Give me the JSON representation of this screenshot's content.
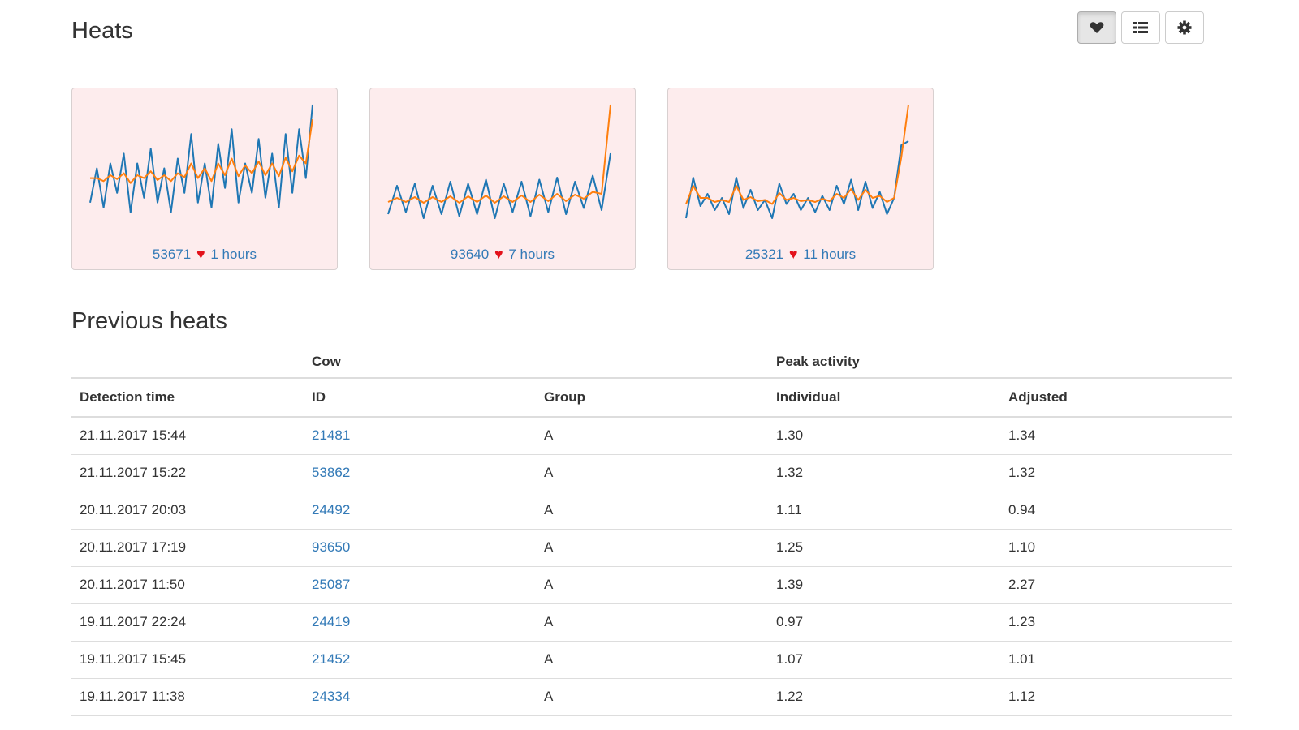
{
  "header": {
    "title": "Heats",
    "toolbar": [
      {
        "name": "heart-button",
        "icon": "heart-icon",
        "active": true
      },
      {
        "name": "list-button",
        "icon": "list-icon",
        "active": false
      },
      {
        "name": "settings-button",
        "icon": "gear-icon",
        "active": false
      }
    ]
  },
  "current_heats": [
    {
      "cow_id": "53671",
      "icon": "heart-icon",
      "elapsed": "1 hours"
    },
    {
      "cow_id": "93640",
      "icon": "heart-icon",
      "elapsed": "7 hours"
    },
    {
      "cow_id": "25321",
      "icon": "heart-icon",
      "elapsed": "11 hours"
    }
  ],
  "colors": {
    "card_background": "#fdeced",
    "raw_activity_line": "#1f77b4",
    "smoothed_activity_line": "#ff7f0e",
    "heart": "#e3121b",
    "link": "#337ab7"
  },
  "chart_data": [
    {
      "type": "line",
      "series": [
        {
          "values": [
            0.2,
            0.55,
            0.15,
            0.6,
            0.3,
            0.7,
            0.1,
            0.6,
            0.25,
            0.75,
            0.2,
            0.55,
            0.1,
            0.65,
            0.3,
            0.9,
            0.2,
            0.6,
            0.15,
            0.8,
            0.35,
            0.95,
            0.2,
            0.6,
            0.3,
            0.85,
            0.25,
            0.7,
            0.15,
            0.9,
            0.3,
            0.95,
            0.45,
            1.2
          ]
        },
        {
          "values": [
            0.45,
            0.45,
            0.42,
            0.48,
            0.44,
            0.5,
            0.4,
            0.48,
            0.45,
            0.52,
            0.43,
            0.48,
            0.42,
            0.5,
            0.46,
            0.6,
            0.45,
            0.55,
            0.42,
            0.6,
            0.48,
            0.65,
            0.47,
            0.58,
            0.5,
            0.62,
            0.48,
            0.6,
            0.47,
            0.66,
            0.52,
            0.68,
            0.6,
            1.05
          ]
        }
      ]
    },
    {
      "type": "line",
      "series": [
        {
          "values": [
            0.2,
            0.9,
            0.25,
            0.95,
            0.1,
            0.9,
            0.2,
            1.0,
            0.15,
            0.95,
            0.2,
            1.05,
            0.1,
            0.95,
            0.25,
            1.0,
            0.15,
            1.05,
            0.25,
            1.1,
            0.2,
            1.0,
            0.35,
            1.15,
            0.3,
            1.7
          ]
        },
        {
          "values": [
            0.5,
            0.6,
            0.5,
            0.62,
            0.48,
            0.62,
            0.5,
            0.64,
            0.48,
            0.64,
            0.5,
            0.66,
            0.48,
            0.64,
            0.5,
            0.66,
            0.5,
            0.68,
            0.52,
            0.7,
            0.52,
            0.68,
            0.58,
            0.75,
            0.7,
            2.9
          ]
        }
      ]
    },
    {
      "type": "line",
      "series": [
        {
          "values": [
            0.1,
            1.1,
            0.4,
            0.7,
            0.3,
            0.6,
            0.2,
            1.1,
            0.35,
            0.8,
            0.3,
            0.55,
            0.1,
            0.95,
            0.45,
            0.7,
            0.3,
            0.6,
            0.25,
            0.65,
            0.3,
            0.9,
            0.45,
            1.05,
            0.3,
            1.0,
            0.35,
            0.75,
            0.2,
            0.6,
            1.9,
            2.0
          ]
        },
        {
          "values": [
            0.45,
            0.9,
            0.6,
            0.6,
            0.5,
            0.55,
            0.5,
            0.9,
            0.55,
            0.62,
            0.52,
            0.55,
            0.45,
            0.72,
            0.55,
            0.6,
            0.52,
            0.55,
            0.5,
            0.58,
            0.52,
            0.7,
            0.6,
            0.82,
            0.55,
            0.8,
            0.6,
            0.65,
            0.5,
            0.6,
            1.6,
            2.9
          ]
        }
      ]
    }
  ],
  "previous_heats": {
    "title": "Previous heats",
    "group_headers": {
      "cow": "Cow",
      "peak_activity": "Peak activity"
    },
    "columns": [
      "Detection time",
      "ID",
      "Group",
      "Individual",
      "Adjusted"
    ],
    "rows": [
      {
        "time": "21.11.2017 15:44",
        "id": "21481",
        "group": "A",
        "individual": "1.30",
        "adjusted": "1.34"
      },
      {
        "time": "21.11.2017 15:22",
        "id": "53862",
        "group": "A",
        "individual": "1.32",
        "adjusted": "1.32"
      },
      {
        "time": "20.11.2017 20:03",
        "id": "24492",
        "group": "A",
        "individual": "1.11",
        "adjusted": "0.94"
      },
      {
        "time": "20.11.2017 17:19",
        "id": "93650",
        "group": "A",
        "individual": "1.25",
        "adjusted": "1.10"
      },
      {
        "time": "20.11.2017 11:50",
        "id": "25087",
        "group": "A",
        "individual": "1.39",
        "adjusted": "2.27"
      },
      {
        "time": "19.11.2017 22:24",
        "id": "24419",
        "group": "A",
        "individual": "0.97",
        "adjusted": "1.23"
      },
      {
        "time": "19.11.2017 15:45",
        "id": "21452",
        "group": "A",
        "individual": "1.07",
        "adjusted": "1.01"
      },
      {
        "time": "19.11.2017 11:38",
        "id": "24334",
        "group": "A",
        "individual": "1.22",
        "adjusted": "1.12"
      }
    ]
  }
}
